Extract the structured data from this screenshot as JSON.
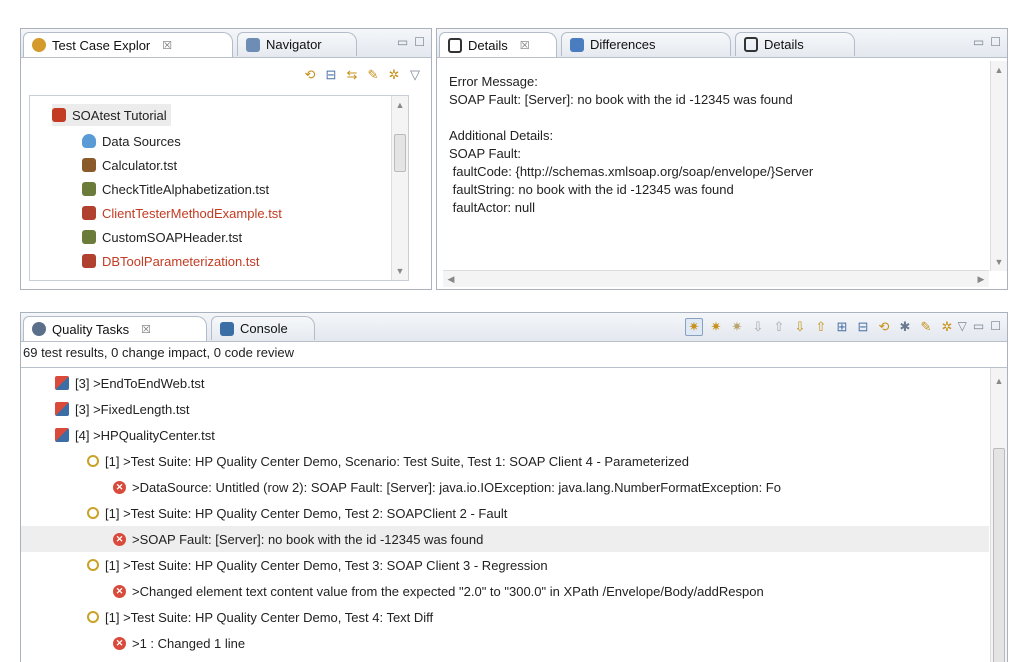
{
  "top_left_pane": {
    "tabs": [
      {
        "label": "Test Case Explor",
        "close": "☒"
      },
      {
        "label": "Navigator"
      }
    ],
    "tree": [
      {
        "label": "SOAtest Tutorial",
        "color": "#222222"
      },
      {
        "label": "Data Sources",
        "color": "#222222"
      },
      {
        "label": "Calculator.tst",
        "color": "#222222"
      },
      {
        "label": "CheckTitleAlphabetization.tst",
        "color": "#222222"
      },
      {
        "label": "ClientTesterMethodExample.tst",
        "color": "#c23b22"
      },
      {
        "label": "CustomSOAPHeader.tst",
        "color": "#222222"
      },
      {
        "label": "DBToolParameterization.tst",
        "color": "#c23b22"
      }
    ]
  },
  "top_right_pane": {
    "tabs": [
      {
        "label": "Details",
        "close": "☒"
      },
      {
        "label": "Differences"
      },
      {
        "label": "Details"
      }
    ],
    "lines": [
      "Error Message:",
      "SOAP Fault: [Server]: no book with the id -12345 was found",
      "",
      "Additional Details:",
      "SOAP Fault:",
      " faultCode: {http://schemas.xmlsoap.org/soap/envelope/}Server",
      " faultString: no book with the id -12345 was found",
      " faultActor: null"
    ]
  },
  "bottom_pane": {
    "tabs": [
      {
        "label": "Quality Tasks",
        "close": "☒"
      },
      {
        "label": "Console"
      }
    ],
    "summary": "69 test results, 0 change impact, 0 code review",
    "rows": [
      {
        "text": "[3] >EndToEndWeb.tst",
        "level": 0,
        "kind": "file"
      },
      {
        "text": "[3] >FixedLength.tst",
        "level": 0,
        "kind": "file"
      },
      {
        "text": "[4] >HPQualityCenter.tst",
        "level": 0,
        "kind": "file"
      },
      {
        "text": "[1] >Test Suite: HP Quality Center Demo, Scenario: Test Suite, Test 1: SOAP Client 4 - Parameterized",
        "level": 1,
        "kind": "warn"
      },
      {
        "text": ">DataSource: Untitled (row 2): SOAP Fault: [Server]: java.io.IOException: java.lang.NumberFormatException: Fo",
        "level": 2,
        "kind": "error"
      },
      {
        "text": "[1] >Test Suite: HP Quality Center Demo, Test 2: SOAPClient 2 - Fault",
        "level": 1,
        "kind": "warn"
      },
      {
        "text": ">SOAP Fault: [Server]: no book with the id -12345 was found",
        "level": 2,
        "kind": "error",
        "selected": true
      },
      {
        "text": "[1] >Test Suite: HP Quality Center Demo, Test 3: SOAP Client 3 - Regression",
        "level": 1,
        "kind": "warn"
      },
      {
        "text": ">Changed element text content value from the expected \"2.0\" to \"300.0\" in XPath /Envelope/Body/addRespon",
        "level": 2,
        "kind": "error"
      },
      {
        "text": "[1] >Test Suite: HP Quality Center Demo, Test 4: Text Diff",
        "level": 1,
        "kind": "warn"
      },
      {
        "text": ">1 : Changed 1 line",
        "level": 2,
        "kind": "error"
      }
    ]
  },
  "colors": {
    "accent": "#3a6ea5",
    "error": "#d94a3a",
    "warning": "#c9a227",
    "red_text": "#c23b22"
  }
}
